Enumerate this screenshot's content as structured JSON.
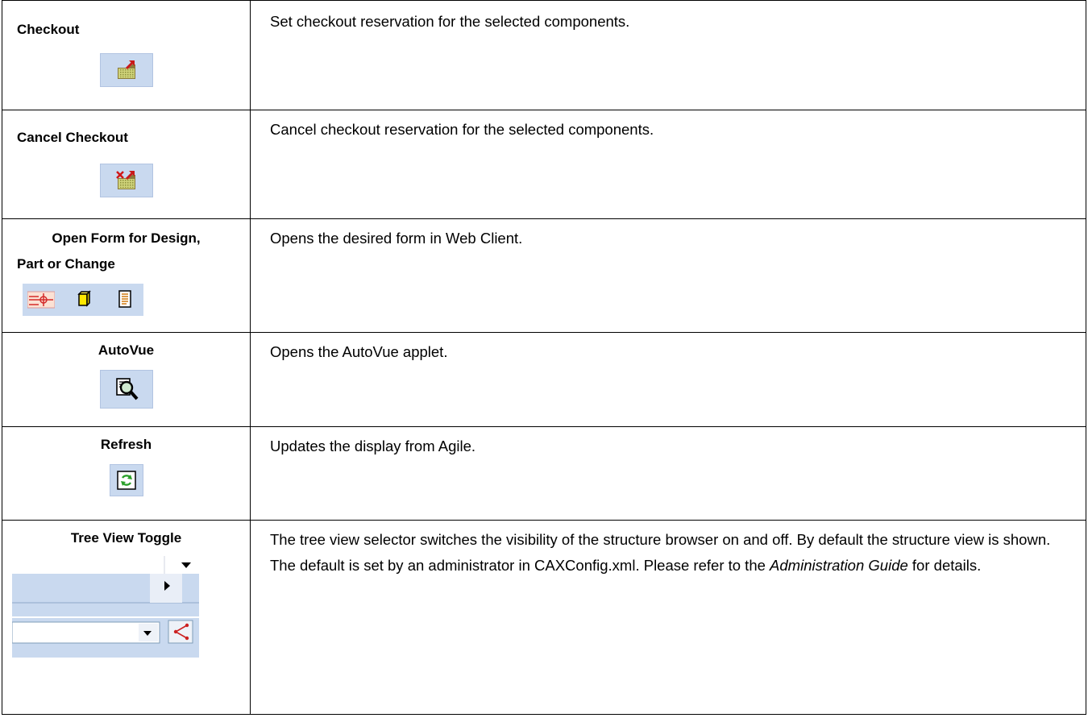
{
  "rows": [
    {
      "label": "Checkout",
      "description": "Set checkout reservation for the selected components.",
      "icon": "checkout-icon"
    },
    {
      "label": "Cancel Checkout",
      "description": "Cancel checkout reservation for the selected components.",
      "icon": "cancel-checkout-icon"
    },
    {
      "label": "Open Form for Design, Part or Change",
      "label_line1": "Open Form for Design,",
      "label_line2": "Part or Change",
      "description": "Opens the desired form in Web Client.",
      "icons": [
        "design-form-icon",
        "part-form-icon",
        "change-form-icon"
      ]
    },
    {
      "label": "AutoVue",
      "description": "Opens the AutoVue applet.",
      "icon": "autovue-icon"
    },
    {
      "label": "Refresh",
      "description": "Updates the display from Agile.",
      "icon": "refresh-icon"
    },
    {
      "label": "Tree View Toggle",
      "description_part1": "The tree view selector switches the visibility of the structure browser on and off. By default the structure view is shown. The default is set by an administrator in CAXConfig.xml. Please refer to the ",
      "description_italic": "Administration Guide",
      "description_part2": " for details.",
      "icon": "tree-view-toggle-icon"
    }
  ],
  "colors": {
    "icon_bg": "#c9d9ef",
    "border": "#000000"
  }
}
